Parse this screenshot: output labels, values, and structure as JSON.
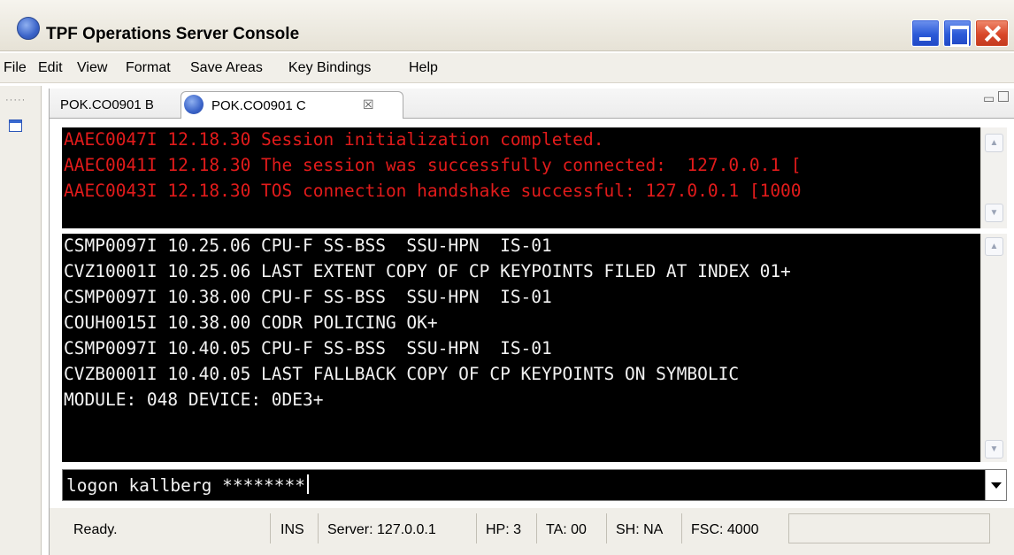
{
  "window": {
    "title": "TPF Operations Server Console"
  },
  "menu": {
    "items": [
      "File",
      "Edit",
      "View",
      "Format",
      "Save Areas",
      "Key Bindings",
      "Help"
    ]
  },
  "tabs": [
    {
      "label": "POK.CO0901 B",
      "active": false
    },
    {
      "label": "POK.CO0901 C",
      "active": true
    }
  ],
  "top_pane": {
    "lines": [
      "AAEC0047I 12.18.30 Session initialization completed.",
      "AAEC0041I 12.18.30 The session was successfully connected:  127.0.0.1 [",
      "AAEC0043I 12.18.30 TOS connection handshake successful: 127.0.0.1 [1000"
    ],
    "color": "#e21b1b"
  },
  "main_pane": {
    "lines": [
      "CSMP0097I 10.25.06 CPU-F SS-BSS  SSU-HPN  IS-01",
      "CVZ10001I 10.25.06 LAST EXTENT COPY OF CP KEYPOINTS FILED AT INDEX 01+",
      "CSMP0097I 10.38.00 CPU-F SS-BSS  SSU-HPN  IS-01",
      "COUH0015I 10.38.00 CODR POLICING OK+",
      "CSMP0097I 10.40.05 CPU-F SS-BSS  SSU-HPN  IS-01",
      "CVZB0001I 10.40.05 LAST FALLBACK COPY OF CP KEYPOINTS ON SYMBOLIC",
      "MODULE: 048 DEVICE: 0DE3+"
    ],
    "color": "#f2f2f2"
  },
  "command": {
    "value": "logon kallberg ********"
  },
  "status": {
    "state": "Ready.",
    "mode": "INS",
    "server": "Server: 127.0.0.1",
    "hp": "HP: 3",
    "ta": "TA: 00",
    "sh": "SH: NA",
    "fsc": "FSC: 4000"
  },
  "icons": {
    "app": "app-globe-icon",
    "tab": "session-globe-icon",
    "close_tab": "close-icon",
    "minimize_view": "minimize-icon",
    "maximize_view": "maximize-icon",
    "dropdown": "chevron-down-icon"
  }
}
